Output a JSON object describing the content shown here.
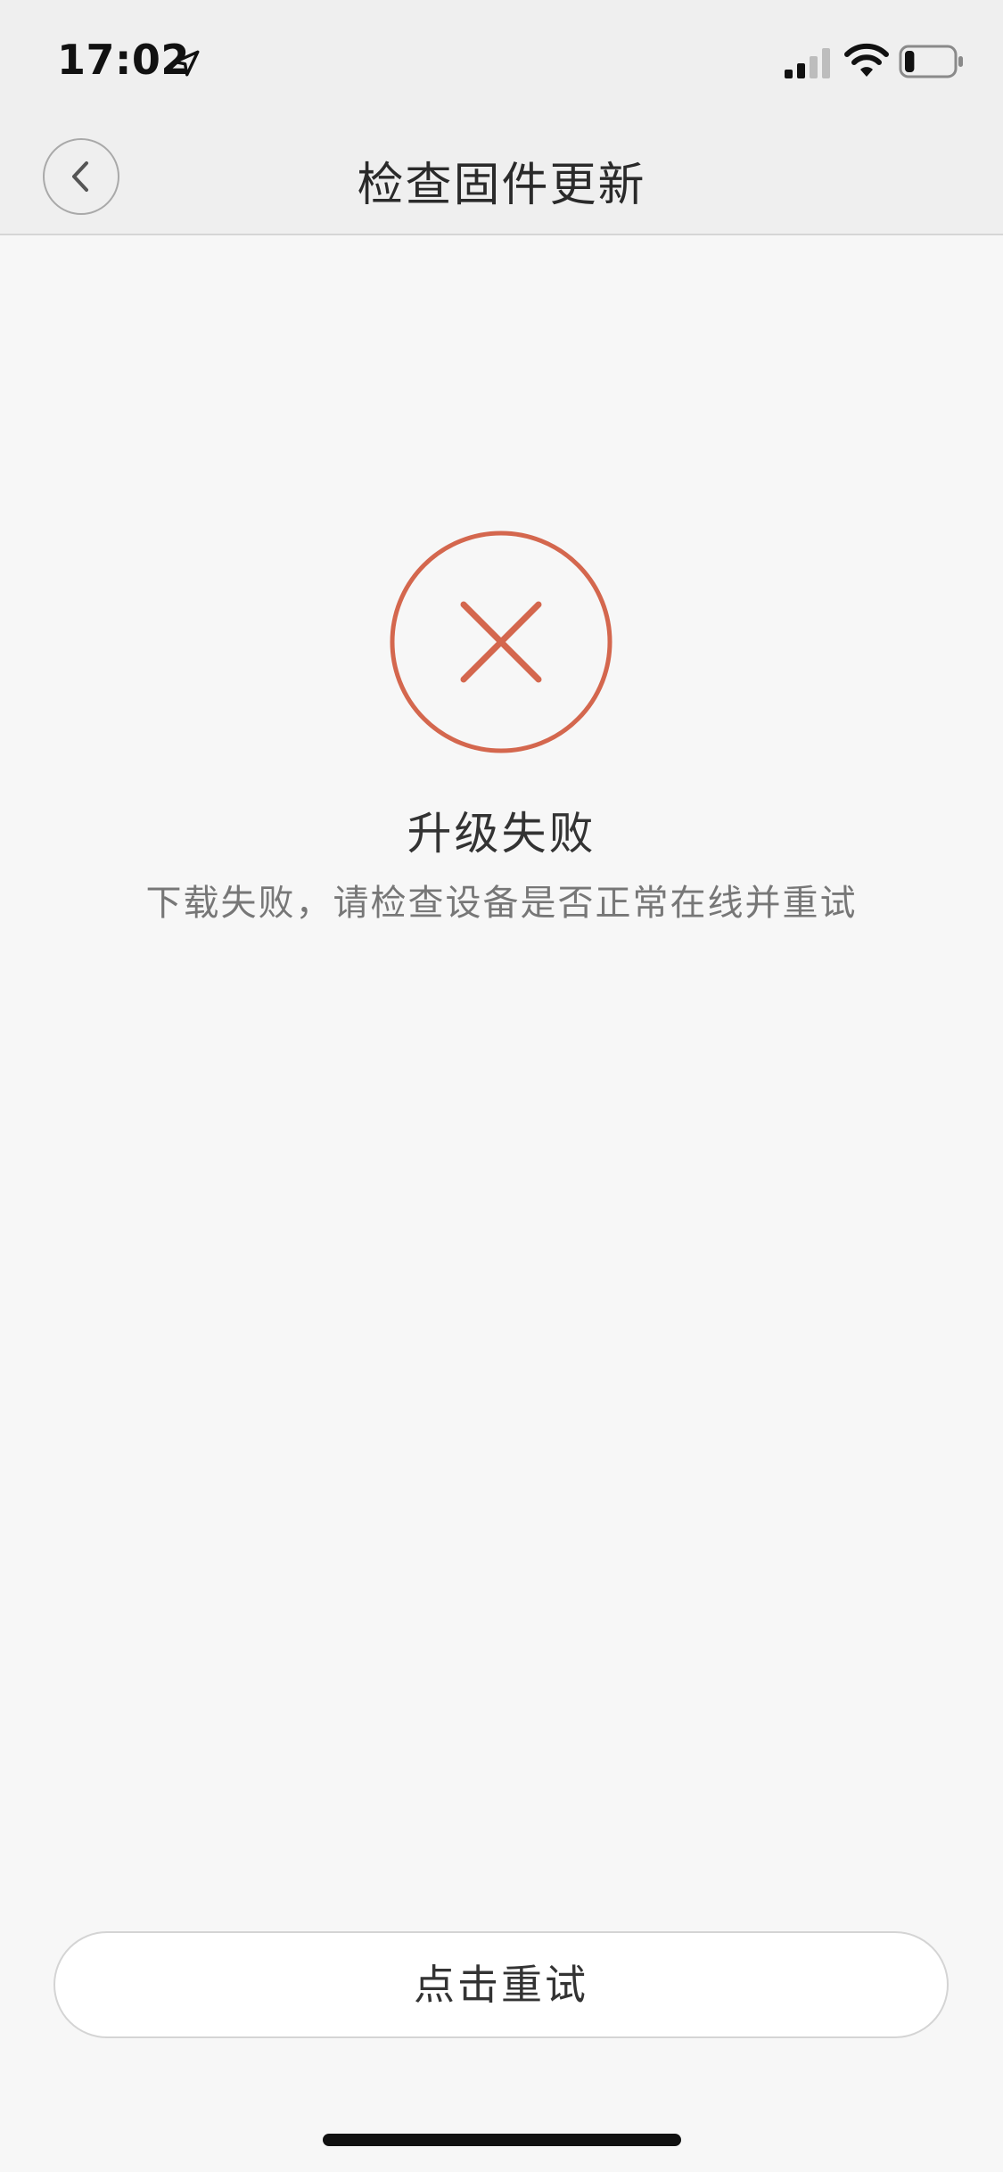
{
  "status_bar": {
    "time": "17:02",
    "location_icon": "location-arrow-icon",
    "signal_icon": "cellular-signal-icon",
    "wifi_icon": "wifi-icon",
    "battery_icon": "battery-icon",
    "battery_level": 0.2
  },
  "nav": {
    "back_icon": "chevron-left-icon",
    "title": "检查固件更新"
  },
  "result": {
    "icon": "close-circle-icon",
    "icon_color": "#d4674e",
    "title": "升级失败",
    "message": "下载失败，请检查设备是否正常在线并重试"
  },
  "actions": {
    "retry_label": "点击重试"
  }
}
